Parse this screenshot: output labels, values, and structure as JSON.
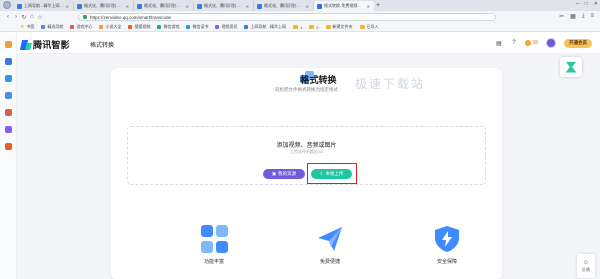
{
  "browser": {
    "tabs": [
      {
        "label": "上网导航 - 精华上网 从这里开始",
        "active": false,
        "color": "#3c7bd9"
      },
      {
        "label": "格式化、腾讯识别视频格式工具",
        "active": false,
        "color": "#3c7bd9"
      },
      {
        "label": "格式化、腾讯识别视频格式工具",
        "active": false,
        "color": "#3c7bd9"
      },
      {
        "label": "格式化、腾讯识别视频格式工具",
        "active": false,
        "color": "#3c7bd9"
      },
      {
        "label": "格式化、腾讯识别视频格式工具",
        "active": false,
        "color": "#3c7bd9"
      },
      {
        "label": "格式转换-免费视频格式转换工具",
        "active": true,
        "color": "#2d6df6"
      }
    ],
    "url": "https://zenvideo.qq.com/smart/transcode",
    "bookmarks": [
      {
        "label": "书签",
        "kind": "star"
      },
      {
        "label": "精选导航",
        "kind": "site",
        "color": "#4a90e2"
      },
      {
        "label": "游戏中心",
        "kind": "site",
        "color": "#e25b4a"
      },
      {
        "label": "小说大全",
        "kind": "site",
        "color": "#f0a030"
      },
      {
        "label": "搜狐视频",
        "kind": "site",
        "color": "#f05a28"
      },
      {
        "label": "微信游戏",
        "kind": "site",
        "color": "#07c160"
      },
      {
        "label": "微信读书",
        "kind": "site",
        "color": "#2b9af3"
      },
      {
        "label": "视频资讯",
        "kind": "site",
        "color": "#8a5cf6"
      },
      {
        "label": "上网导航 - 精华上网",
        "kind": "site",
        "color": "#3c7bd9"
      },
      {
        "label": "1",
        "kind": "folder"
      },
      {
        "label": "2",
        "kind": "folder"
      },
      {
        "label": "新建文件夹",
        "kind": "folder"
      },
      {
        "label": "已导入",
        "kind": "folder"
      }
    ]
  },
  "header": {
    "logo_text": "腾讯智影",
    "nav_title": "格式转换",
    "coin_count": "38",
    "vip_label": "开通会员"
  },
  "main": {
    "title": "格式转换",
    "subtitle": "轻松把文件格式转换为指定格式",
    "watermark": "极速下载站",
    "upload": {
      "title": "添加视频、音频或图片",
      "hint": "上传文件不超过1G",
      "my_resources_label": "我的资源",
      "local_upload_label": "本地上传"
    },
    "features": [
      {
        "label": "功能丰富",
        "icon": "grid-icon"
      },
      {
        "label": "免费便捷",
        "icon": "paper-plane-icon"
      },
      {
        "label": "安全保障",
        "icon": "shield-icon"
      }
    ]
  },
  "feedback_label": "反馈",
  "colors": {
    "brand_blue": "#1f6bff",
    "brand_green": "#22d3a0",
    "local_upload_button": "#1fc7a0",
    "my_resources_button": "#6f5ddc",
    "highlight_box": "#e02020"
  }
}
